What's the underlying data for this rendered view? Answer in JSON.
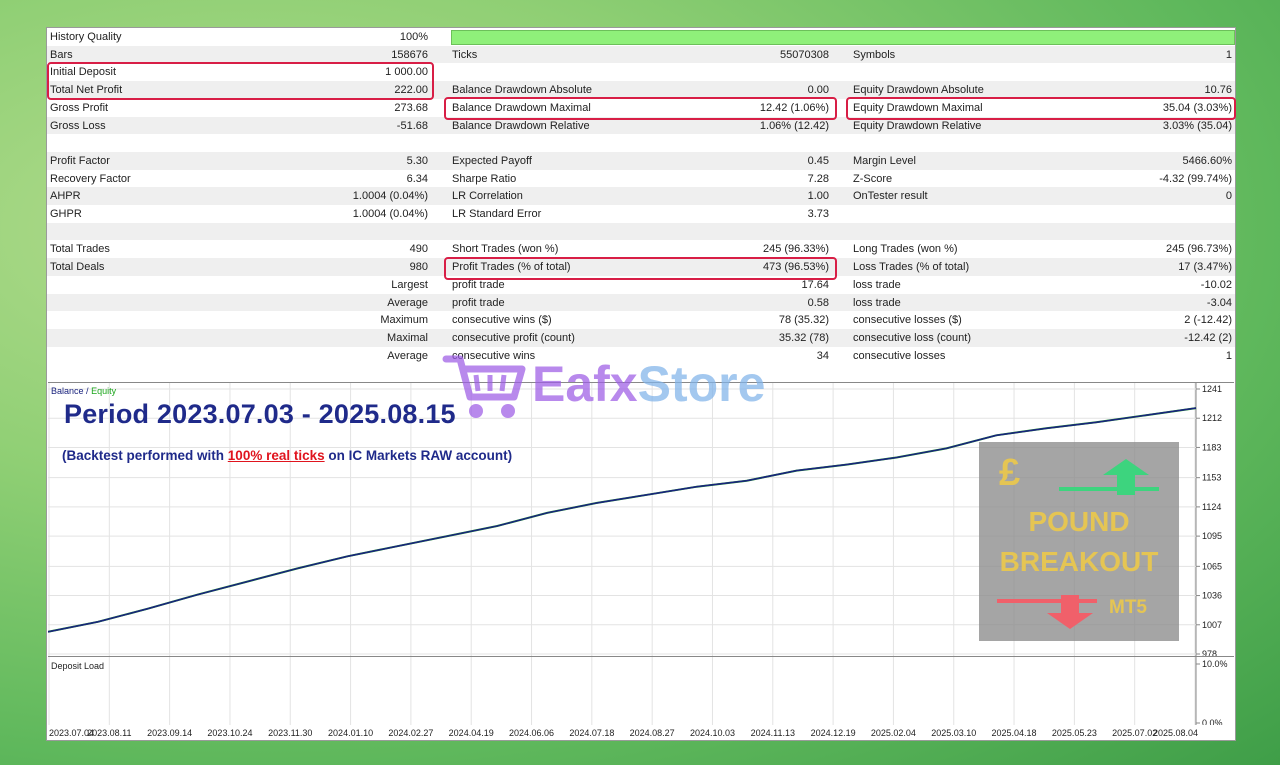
{
  "report": {
    "history_quality_label": "History Quality",
    "history_quality_value": "100%",
    "bars_label": "Bars",
    "bars_value": "158676",
    "ticks_label": "Ticks",
    "ticks_value": "55070308",
    "symbols_label": "Symbols",
    "symbols_value": "1",
    "initial_deposit_label": "Initial Deposit",
    "initial_deposit_value": "1 000.00",
    "total_net_profit_label": "Total Net Profit",
    "total_net_profit_value": "222.00",
    "balance_dd_abs_label": "Balance Drawdown Absolute",
    "balance_dd_abs_value": "0.00",
    "equity_dd_abs_label": "Equity Drawdown Absolute",
    "equity_dd_abs_value": "10.76",
    "gross_profit_label": "Gross Profit",
    "gross_profit_value": "273.68",
    "balance_dd_max_label": "Balance Drawdown Maximal",
    "balance_dd_max_value": "12.42 (1.06%)",
    "equity_dd_max_label": "Equity Drawdown Maximal",
    "equity_dd_max_value": "35.04 (3.03%)",
    "gross_loss_label": "Gross Loss",
    "gross_loss_value": "-51.68",
    "balance_dd_rel_label": "Balance Drawdown Relative",
    "balance_dd_rel_value": "1.06% (12.42)",
    "equity_dd_rel_label": "Equity Drawdown Relative",
    "equity_dd_rel_value": "3.03% (35.04)",
    "profit_factor_label": "Profit Factor",
    "profit_factor_value": "5.30",
    "expected_payoff_label": "Expected Payoff",
    "expected_payoff_value": "0.45",
    "margin_level_label": "Margin Level",
    "margin_level_value": "5466.60%",
    "recovery_factor_label": "Recovery Factor",
    "recovery_factor_value": "6.34",
    "sharpe_label": "Sharpe Ratio",
    "sharpe_value": "7.28",
    "zscore_label": "Z-Score",
    "zscore_value": "-4.32 (99.74%)",
    "ahpr_label": "AHPR",
    "ahpr_value": "1.0004 (0.04%)",
    "lr_corr_label": "LR Correlation",
    "lr_corr_value": "1.00",
    "ontester_label": "OnTester result",
    "ontester_value": "0",
    "ghpr_label": "GHPR",
    "ghpr_value": "1.0004 (0.04%)",
    "lr_stderr_label": "LR Standard Error",
    "lr_stderr_value": "3.73",
    "total_trades_label": "Total Trades",
    "total_trades_value": "490",
    "short_trades_label": "Short Trades (won %)",
    "short_trades_value": "245 (96.33%)",
    "long_trades_label": "Long Trades (won %)",
    "long_trades_value": "245 (96.73%)",
    "total_deals_label": "Total Deals",
    "total_deals_value": "980",
    "profit_trades_label": "Profit Trades (% of total)",
    "profit_trades_value": "473 (96.53%)",
    "loss_trades_label": "Loss Trades (% of total)",
    "loss_trades_value": "17 (3.47%)",
    "largest_label": "Largest",
    "largest_profit_label": "profit trade",
    "largest_profit_value": "17.64",
    "largest_loss_label": "loss trade",
    "largest_loss_value": "-10.02",
    "average_label": "Average",
    "average_profit_label": "profit trade",
    "average_profit_value": "0.58",
    "average_loss_label": "loss trade",
    "average_loss_value": "-3.04",
    "maximum_label": "Maximum",
    "max_cons_wins_label": "consecutive wins ($)",
    "max_cons_wins_value": "78 (35.32)",
    "max_cons_losses_label": "consecutive losses ($)",
    "max_cons_losses_value": "2 (-12.42)",
    "maximal_label": "Maximal",
    "maximal_profit_label": "consecutive profit (count)",
    "maximal_profit_value": "35.32 (78)",
    "maximal_loss_label": "consecutive loss (count)",
    "maximal_loss_value": "-12.42 (2)",
    "average2_label": "Average",
    "avg_cons_wins_label": "consecutive wins",
    "avg_cons_wins_value": "34",
    "avg_cons_losses_label": "consecutive losses",
    "avg_cons_losses_value": "1"
  },
  "chart": {
    "legend_balance": "Balance",
    "legend_sep": "/",
    "legend_equity": "Equity",
    "period_title": "Period 2023.07.03 - 2025.08.15",
    "note_prefix": "(Backtest performed with ",
    "note_highlight": "100% real ticks",
    "note_suffix": " on IC Markets RAW account)",
    "deposit_load_label": "Deposit Load",
    "colors": {
      "balance": "#1a237e",
      "equity": "#1aa51a",
      "highlight": "#d81e46"
    }
  },
  "chart_data": {
    "type": "line",
    "title": "",
    "xlabel": "",
    "ylabel": "",
    "y_ticks": [
      "1241",
      "1212",
      "1183",
      "1153",
      "1124",
      "1095",
      "1065",
      "1036",
      "1007",
      "978"
    ],
    "ylim": [
      978,
      1241
    ],
    "x_ticks": [
      "2023.07.04",
      "2023.08.11",
      "2023.09.14",
      "2023.10.24",
      "2023.11.30",
      "2024.01.10",
      "2024.02.27",
      "2024.04.19",
      "2024.06.06",
      "2024.07.18",
      "2024.08.27",
      "2024.10.03",
      "2024.11.13",
      "2024.12.19",
      "2025.02.04",
      "2025.03.10",
      "2025.04.18",
      "2025.05.23",
      "2025.07.02",
      "2025.08.04"
    ],
    "series": [
      {
        "name": "Balance",
        "values": [
          1000,
          1010,
          1023,
          1037,
          1050,
          1063,
          1075,
          1085,
          1095,
          1105,
          1118,
          1128,
          1136,
          1144,
          1150,
          1160,
          1166,
          1173,
          1182,
          1195,
          1202,
          1208,
          1215,
          1222
        ]
      },
      {
        "name": "Equity",
        "values": [
          1000,
          1010,
          1023,
          1037,
          1050,
          1063,
          1075,
          1085,
          1095,
          1105,
          1118,
          1128,
          1136,
          1144,
          1150,
          1160,
          1166,
          1173,
          1182,
          1195,
          1202,
          1208,
          1215,
          1222
        ]
      }
    ],
    "lower_panel": {
      "label": "Deposit Load",
      "y_ticks": [
        "10.0%",
        "0.0%"
      ],
      "ylim": [
        0,
        10
      ]
    }
  },
  "watermark": {
    "brand_a": "Eafx",
    "brand_b": "Store"
  },
  "promo": {
    "symbol": "£",
    "line1": "POUND",
    "line2": "BREAKOUT",
    "badge": "MT5"
  }
}
